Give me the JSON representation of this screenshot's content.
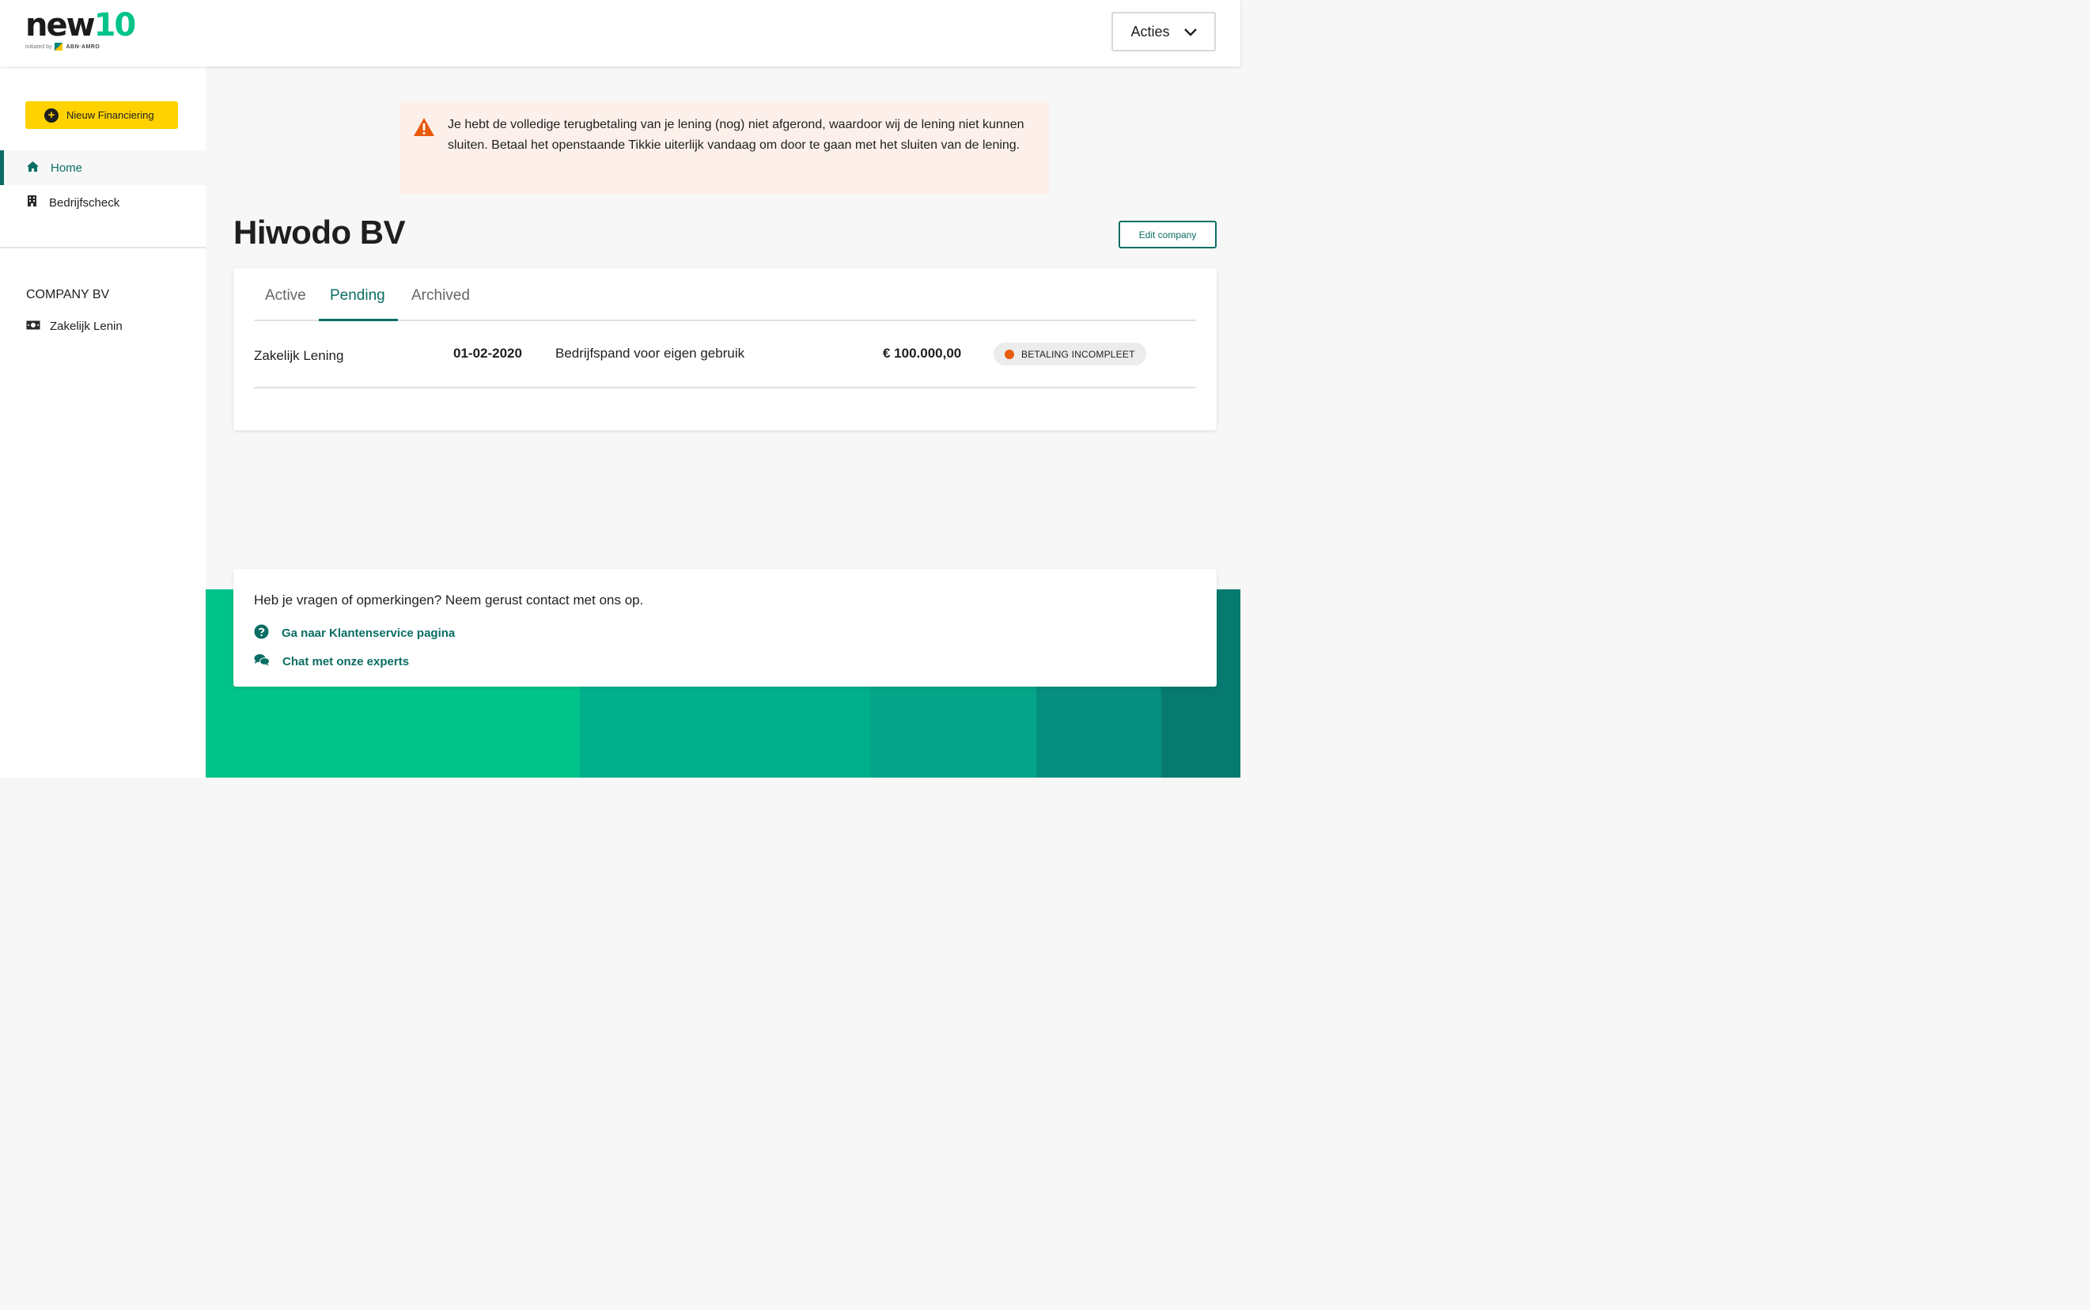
{
  "brand": {
    "logo_part1": "new",
    "logo_part2": "10",
    "tagline": "initiated by",
    "partner": "ABN·AMRO",
    "colors": {
      "primary": "#0b6e64",
      "accent_green": "#00c389",
      "yellow": "#ffd200",
      "alert_orange": "#e85a0c"
    }
  },
  "header": {
    "actions_label": "Acties",
    "actions_icon": "chevron-down-icon"
  },
  "sidebar": {
    "new_button_label": "Nieuw Financiering",
    "nav": [
      {
        "label": "Home",
        "icon": "home-icon",
        "active": true
      },
      {
        "label": "Bedrijfscheck",
        "icon": "building-icon",
        "active": false
      }
    ],
    "company_label": "COMPANY BV",
    "company_items": [
      {
        "label": "Zakelijk Lenin",
        "icon": "money-icon"
      }
    ]
  },
  "alert": {
    "icon": "warning-icon",
    "text": "Je hebt de volledige terugbetaling van je lening (nog) niet afgerond, waardoor wij de lening niet kunnen sluiten. Betaal het openstaande Tikkie uiterlijk vandaag om door te gaan met het sluiten van de lening."
  },
  "company": {
    "name": "Hiwodo BV",
    "edit_label": "Edit company"
  },
  "loans": {
    "tabs": [
      {
        "label": "Active",
        "selected": false
      },
      {
        "label": "Pending",
        "selected": true
      },
      {
        "label": "Archived",
        "selected": false
      }
    ],
    "rows": [
      {
        "product": "Zakelijk Lening",
        "date": "01-02-2020",
        "purpose": "Bedrijfspand voor eigen gebruik",
        "amount": "€ 100.000,00",
        "status": "BETALING INCOMPLEET"
      }
    ]
  },
  "help": {
    "title": "Heb je vragen of opmerkingen? Neem gerust contact met ons op.",
    "links": [
      {
        "label": "Ga naar Klantenservice pagina",
        "icon": "question-circle-icon"
      },
      {
        "label": "Chat met onze experts",
        "icon": "chat-icon"
      }
    ]
  },
  "footer_colors": [
    "#00c389",
    "#00b08a",
    "#03a487",
    "#068f7f",
    "#077a6f"
  ]
}
